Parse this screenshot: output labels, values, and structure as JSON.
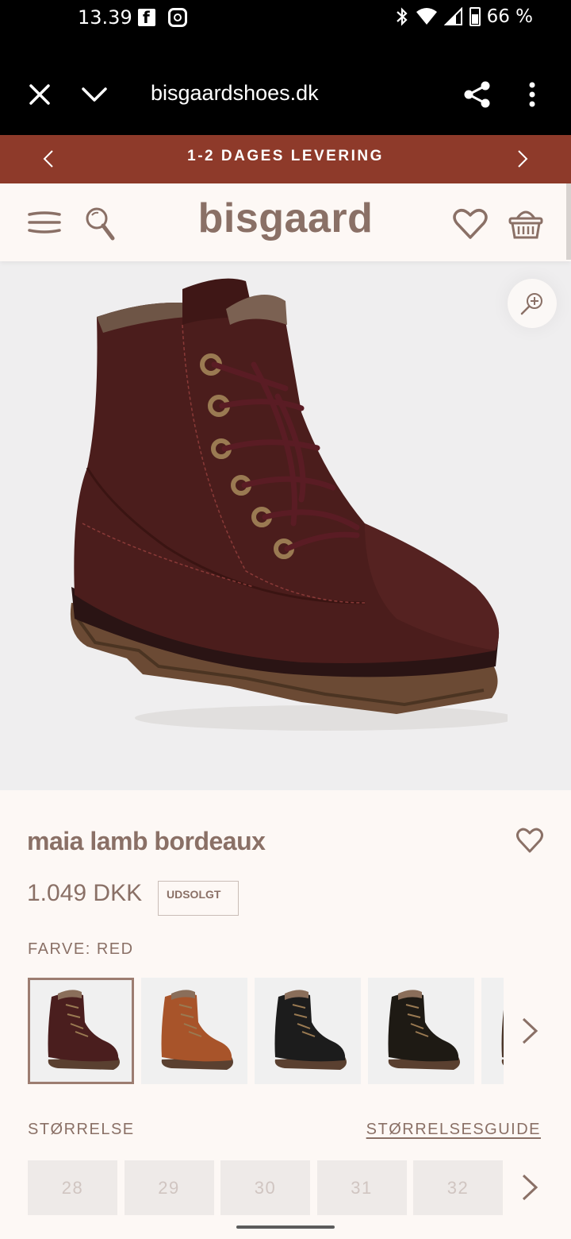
{
  "status_bar": {
    "time": "13.39",
    "facebook_glyph": "f",
    "battery": "66 %"
  },
  "browser": {
    "url": "bisgaardshoes.dk"
  },
  "promo": {
    "text": "1-2 DAGES LEVERING"
  },
  "site": {
    "logo": "bisgaard"
  },
  "product": {
    "title": "maia lamb bordeaux",
    "price": "1.049 DKK",
    "badge": "UDSOLGT",
    "color_label": "FARVE: RED",
    "image_index": 1,
    "image_count": 4,
    "swatches": [
      {
        "color": "#4a1e1e",
        "selected": true
      },
      {
        "color": "#a8542a",
        "selected": false
      },
      {
        "color": "#1c1c1c",
        "selected": false
      },
      {
        "color": "#1e1a14",
        "selected": false
      },
      {
        "color": "#4a3528",
        "selected": false
      }
    ]
  },
  "size": {
    "label": "STØRRELSE",
    "guide": "STØRRELSESGUIDE",
    "options": [
      "28",
      "29",
      "30",
      "31",
      "32"
    ]
  },
  "colors": {
    "brand": "#8a7066",
    "promo_bg": "#8e3a2a",
    "boot": "#4b1d1c"
  }
}
